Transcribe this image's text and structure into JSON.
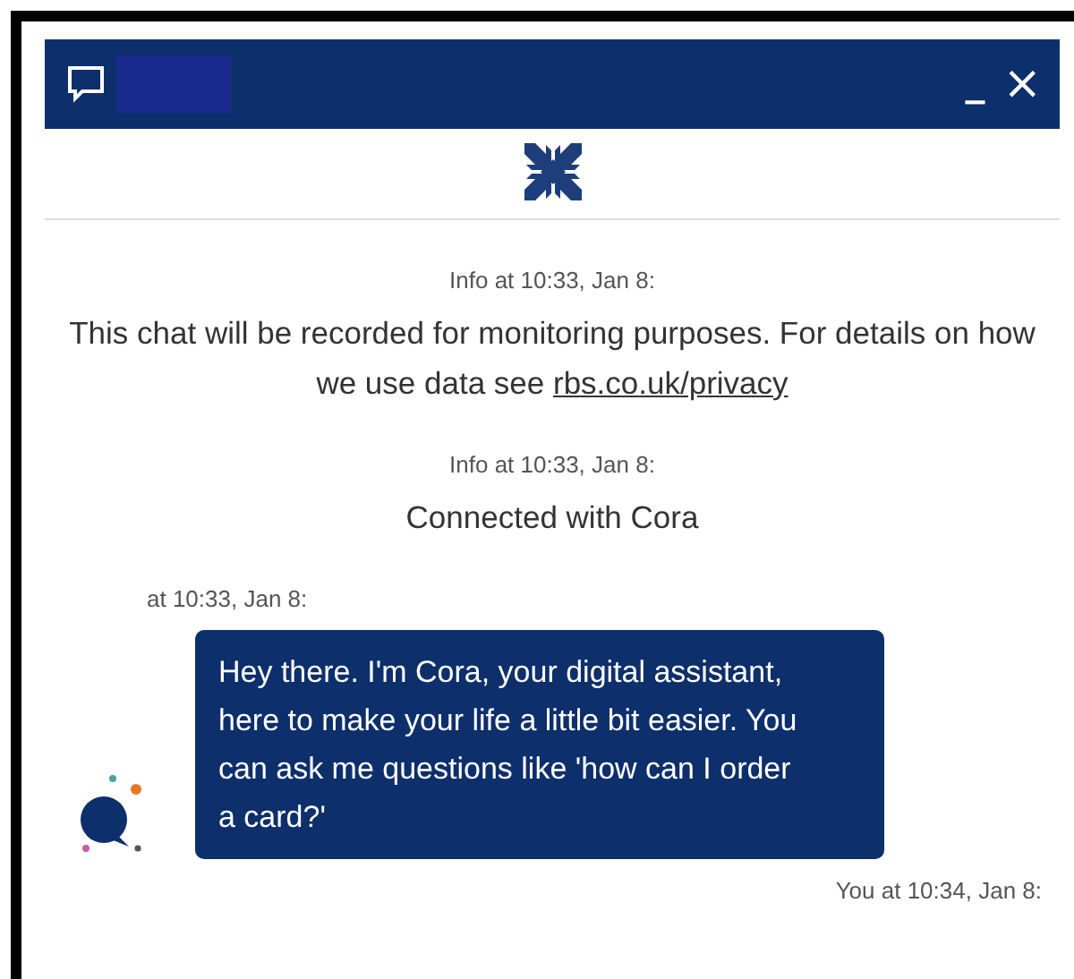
{
  "window": {
    "title_redacted": true,
    "controls": [
      "_",
      "×"
    ]
  },
  "messages": [
    {
      "kind": "info",
      "meta": "Info at 10:33, Jan 8:",
      "text": "This chat will be recorded for monitoring purposes. For details on how we use data see ",
      "link": "rbs.co.uk/privacy"
    },
    {
      "kind": "info",
      "meta": "Info at 10:33, Jan 8:",
      "text": "Connected with Cora"
    },
    {
      "kind": "agent",
      "meta": "at 10:33, Jan 8:",
      "text": "Hey there. I'm Cora, your digital assistant, here to make your life a little bit easier. You can ask me questions like 'how can I order a card?'"
    },
    {
      "kind": "user",
      "meta": "You at 10:34, Jan 8:"
    }
  ]
}
